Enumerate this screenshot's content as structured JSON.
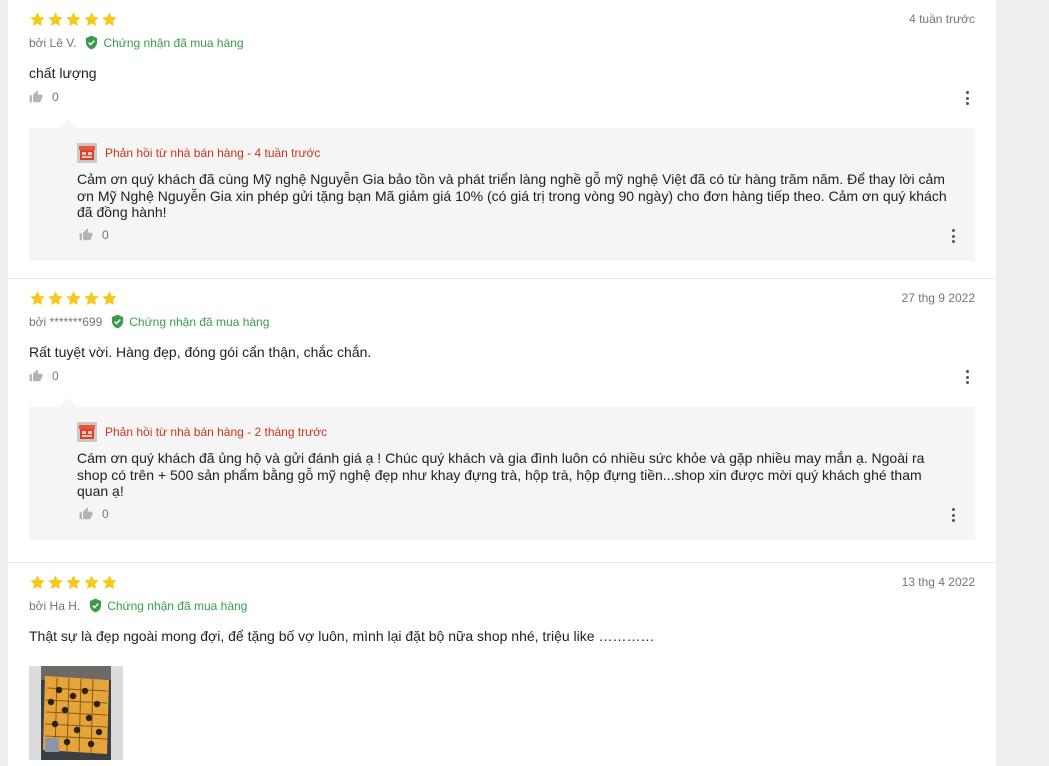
{
  "reviews": [
    {
      "rating": 5,
      "date": "4 tuần trước",
      "author": "bởi Lê V.",
      "verified": "Chứng nhận đã mua hàng",
      "content": "chất lượng",
      "likes": "0",
      "reply": {
        "header": "Phản hồi từ nhà bán hàng - 4 tuần trước",
        "lines": [
          "Cảm ơn quý khách đã cùng Mỹ nghệ Nguyễn Gia bảo tồn và phát triển làng nghề gỗ mỹ nghệ Việt đã có từ hàng trăm năm. Để thay lời cảm",
          "ơn Mỹ Nghệ Nguyễn Gia xin phép gửi tặng bạn Mã giảm giá 10% (có giá trị trong vòng 90 ngày) cho đơn hàng tiếp theo. Cảm ơn quý khách",
          "đã đồng hành!"
        ],
        "likes": "0"
      }
    },
    {
      "rating": 5,
      "date": "27 thg 9 2022",
      "author": "bởi *******699",
      "verified": "Chứng nhận đã mua hàng",
      "content": "Rất tuyệt vời. Hàng đẹp, đóng gói cẩn thận, chắc chắn.",
      "likes": "0",
      "reply": {
        "header": "Phản hồi từ nhà bán hàng - 2 tháng trước",
        "lines": [
          "Cám ơn quý khách đã ủng hộ và gửi đánh giá ạ ! Chúc quý khách và gia đình luôn có nhiều sức khỏe và gặp nhiều may mắn ạ. Ngoài ra",
          "shop có trên + 500 sản phẩm bằng gỗ mỹ nghệ đẹp như khay đựng trà, hộp trà, hộp đựng tiền...shop xin được mời quý khách ghé tham",
          "quan ạ!"
        ],
        "likes": "0"
      }
    },
    {
      "rating": 5,
      "date": "13 thg 4 2022",
      "author": "bởi Ha H.",
      "verified": "Chứng nhận đã mua hàng",
      "content": "Thật sự là đẹp ngoài mong đợi, để tặng bố vợ luôn, mình lại đặt bộ nữa shop nhé, triệu like …………"
    }
  ],
  "colors": {
    "star": "#fadb14",
    "verified": "#3c9a4a",
    "seller_reply": "#d0321b",
    "reply_bg": "#f5f5f6"
  },
  "icons": {
    "star": "star-icon",
    "verified": "check-shield-icon",
    "like": "thumbs-up-icon",
    "more": "more-vertical-icon",
    "shop": "shop-icon"
  }
}
